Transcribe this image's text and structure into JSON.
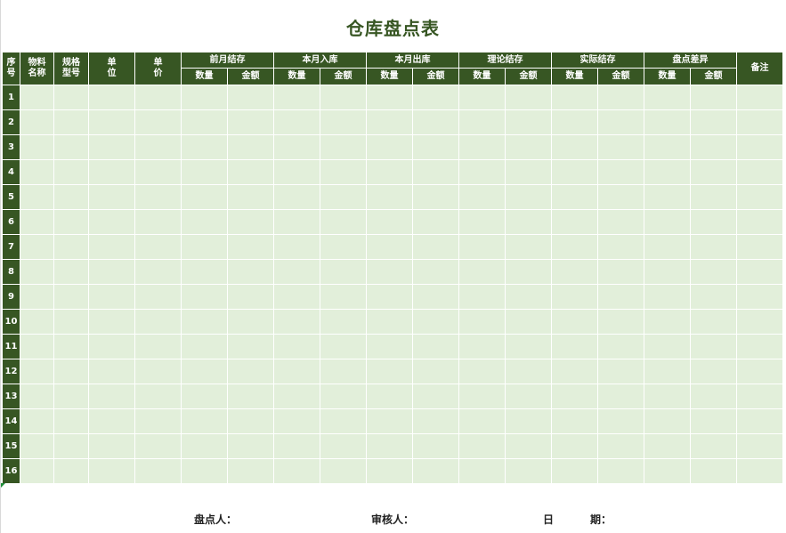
{
  "title": "仓库盘点表",
  "header": {
    "seq": "序号",
    "material": "物料名称",
    "spec": "规格型号",
    "unit": "单位",
    "price": "单价",
    "groups": [
      "前月结存",
      "本月入库",
      "本月出库",
      "理论结存",
      "实际结存",
      "盘点差异"
    ],
    "qty": "数量",
    "amount": "金额",
    "remark": "备注"
  },
  "rows": [
    "1",
    "2",
    "3",
    "4",
    "5",
    "6",
    "7",
    "8",
    "9",
    "10",
    "11",
    "12",
    "13",
    "14",
    "15",
    "16"
  ],
  "footer": {
    "counter": "盘点人：",
    "reviewer": "审核人：",
    "date_day": "日",
    "date_period": "期："
  },
  "colors": {
    "header_bg": "#375623",
    "cell_bg": "#e2efda",
    "title": "#375623"
  }
}
